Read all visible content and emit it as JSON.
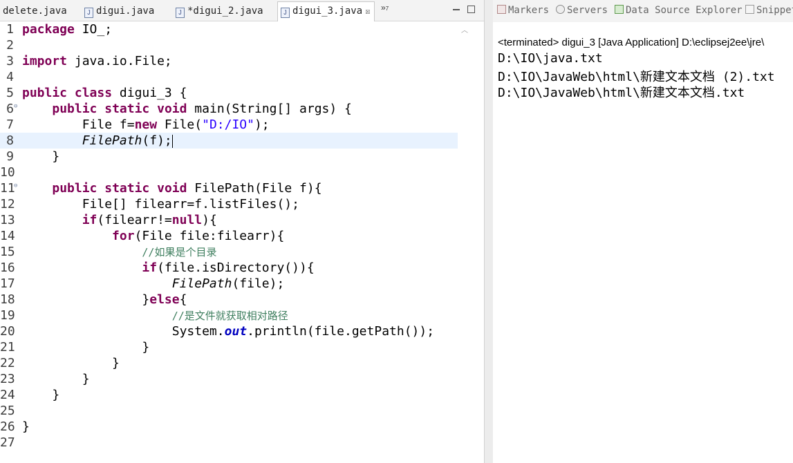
{
  "editor": {
    "tabs": [
      {
        "label": "delete.java",
        "icon": "none",
        "active": false
      },
      {
        "label": "digui.java",
        "icon": "java-file-icon",
        "active": false
      },
      {
        "label": "*digui_2.java",
        "icon": "java-file-icon",
        "active": false
      },
      {
        "label": "digui_3.java",
        "icon": "java-file-icon",
        "active": true
      }
    ],
    "overflow_label": "»",
    "overflow_count": "7",
    "tab_close_glyph": "☒",
    "icon_letter": "J",
    "line_numbers": [
      "1",
      "2",
      "3",
      "4",
      "5",
      "6",
      "7",
      "8",
      "9",
      "10",
      "11",
      "12",
      "13",
      "14",
      "15",
      "16",
      "17",
      "18",
      "19",
      "20",
      "21",
      "22",
      "23",
      "24",
      "25",
      "26",
      "27"
    ],
    "fold_markers": {
      "6": "⊖",
      "11": "⊖"
    },
    "current_line": 8
  },
  "console": {
    "tabs": [
      {
        "label": "Markers",
        "icon": "markers-icon"
      },
      {
        "label": "Servers",
        "icon": "servers-icon"
      },
      {
        "label": "Data Source Explorer",
        "icon": "data-source-explorer-icon"
      },
      {
        "label": "Snippets",
        "icon": "snippets-icon"
      }
    ],
    "terminated_line": "<terminated> digui_3 [Java Application] D:\\eclipsej2ee\\jre\\",
    "output": [
      "D:\\IO\\java.txt",
      "D:\\IO\\JavaWeb\\html\\新建文本文档 (2).txt",
      "D:\\IO\\JavaWeb\\html\\新建文本文档.txt"
    ]
  },
  "colors": {
    "keyword": "#7f0055",
    "string": "#2a00ff",
    "comment": "#3f7f5f",
    "current_line_bg": "#e8f2fe"
  }
}
